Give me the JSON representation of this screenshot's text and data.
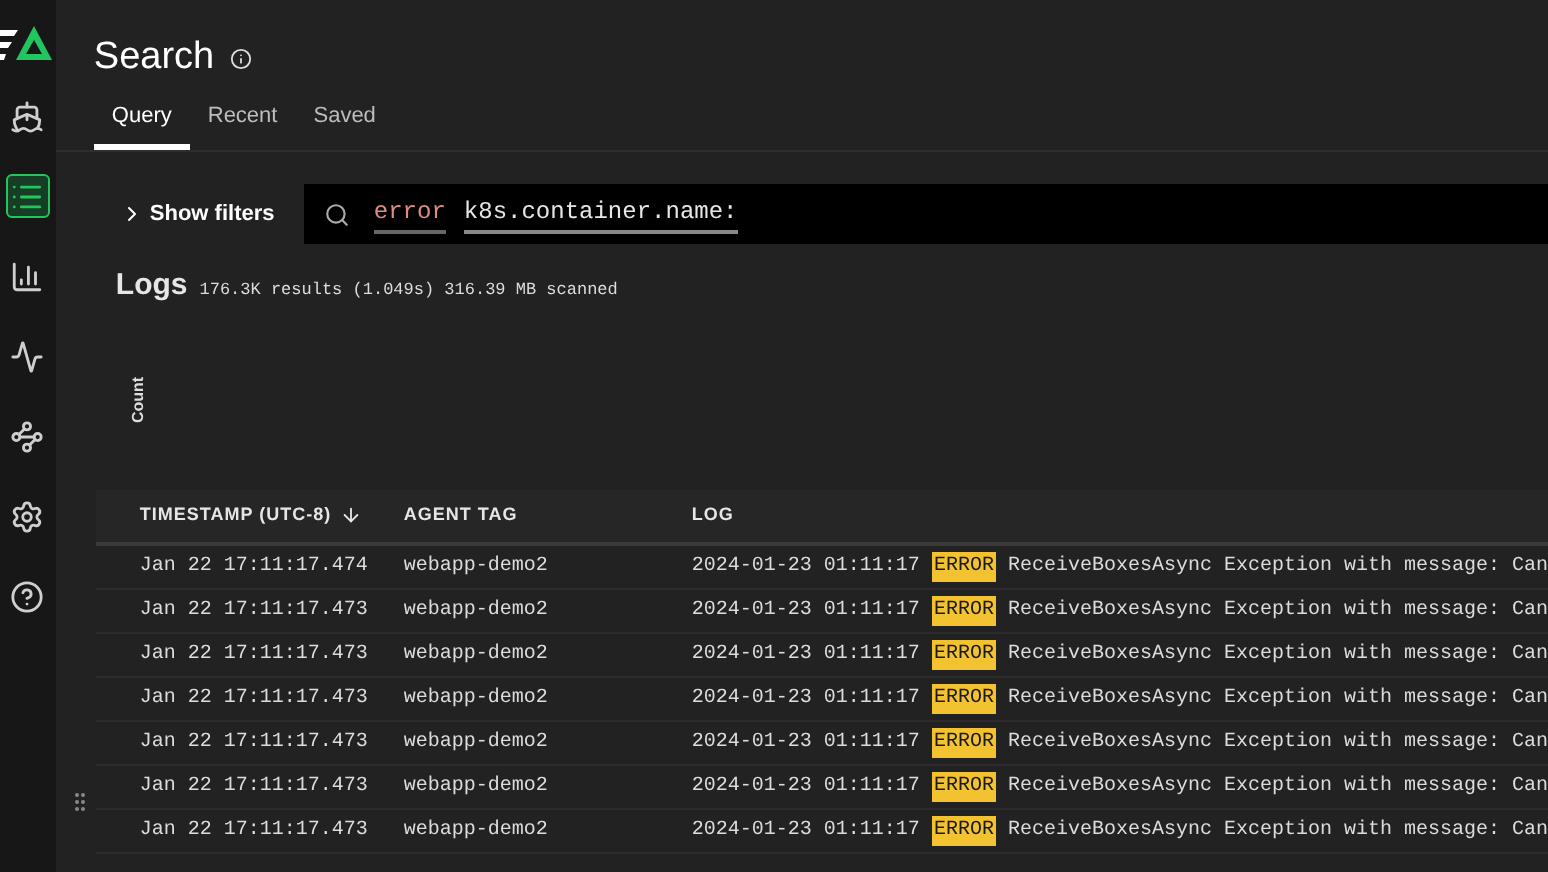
{
  "sidebar": {
    "items": [
      {
        "kind": "wheel",
        "selected": false
      },
      {
        "kind": "list",
        "selected": true
      },
      {
        "kind": "chart",
        "selected": false
      },
      {
        "kind": "pulse",
        "selected": false
      },
      {
        "kind": "pipe",
        "selected": false
      },
      {
        "kind": "gear",
        "selected": false
      },
      {
        "kind": "help",
        "selected": false
      }
    ]
  },
  "header": {
    "title": "Search"
  },
  "tabs": [
    {
      "label": "Query",
      "selected": true
    },
    {
      "label": "Recent",
      "selected": false
    },
    {
      "label": "Saved",
      "selected": false
    }
  ],
  "filters_toggle": {
    "label": "Show filters"
  },
  "search": {
    "tokens": [
      {
        "text": "error",
        "kind": "keyword"
      },
      {
        "text": "k8s.container.name:",
        "kind": "field"
      }
    ]
  },
  "logs": {
    "title": "Logs",
    "summary": "176.3K results (1.049s) 316.39 MB scanned",
    "axis_label": "Count"
  },
  "table": {
    "columns": [
      {
        "label": "TIMESTAMP (UTC-8)",
        "sorted": true
      },
      {
        "label": "AGENT TAG",
        "sorted": false
      },
      {
        "label": "LOG",
        "sorted": false
      }
    ],
    "rows": [
      {
        "timestamp": "Jan 22 17:11:17.474",
        "agent": "webapp-demo2",
        "time": "2024-01-23 01:11:17",
        "level": "ERROR",
        "message": "ReceiveBoxesAsync Exception with message: Can"
      },
      {
        "timestamp": "Jan 22 17:11:17.473",
        "agent": "webapp-demo2",
        "time": "2024-01-23 01:11:17",
        "level": "ERROR",
        "message": "ReceiveBoxesAsync Exception with message: Can"
      },
      {
        "timestamp": "Jan 22 17:11:17.473",
        "agent": "webapp-demo2",
        "time": "2024-01-23 01:11:17",
        "level": "ERROR",
        "message": "ReceiveBoxesAsync Exception with message: Can"
      },
      {
        "timestamp": "Jan 22 17:11:17.473",
        "agent": "webapp-demo2",
        "time": "2024-01-23 01:11:17",
        "level": "ERROR",
        "message": "ReceiveBoxesAsync Exception with message: Can"
      },
      {
        "timestamp": "Jan 22 17:11:17.473",
        "agent": "webapp-demo2",
        "time": "2024-01-23 01:11:17",
        "level": "ERROR",
        "message": "ReceiveBoxesAsync Exception with message: Can"
      },
      {
        "timestamp": "Jan 22 17:11:17.473",
        "agent": "webapp-demo2",
        "time": "2024-01-23 01:11:17",
        "level": "ERROR",
        "message": "ReceiveBoxesAsync Exception with message: Can"
      },
      {
        "timestamp": "Jan 22 17:11:17.473",
        "agent": "webapp-demo2",
        "time": "2024-01-23 01:11:17",
        "level": "ERROR",
        "message": "ReceiveBoxesAsync Exception with message: Can"
      }
    ]
  }
}
